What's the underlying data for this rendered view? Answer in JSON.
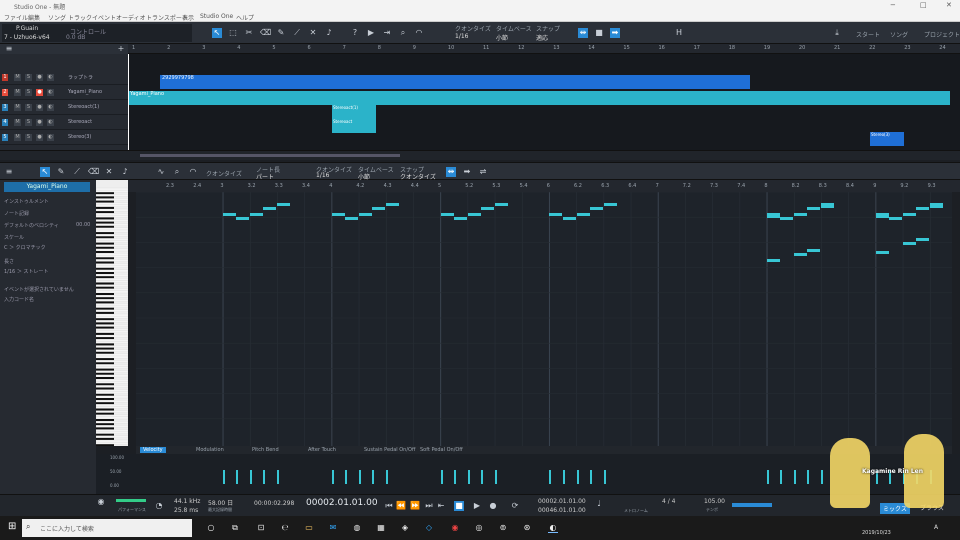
{
  "app": {
    "title": "Studio One - 無題",
    "window_controls": [
      "−",
      "□",
      "✕"
    ]
  },
  "menu": [
    "ファイル",
    "編集",
    "ソング",
    "トラック",
    "イベント",
    "オーディオ",
    "トランスポート",
    "表示",
    "Studio One",
    "ヘルプ"
  ],
  "toolbar": {
    "channel": "P.Guain",
    "preset": "7 - Uzhuo6-v64",
    "control_label": "コントロール",
    "db_value": "0.0 dB",
    "quantize_label": "クオンタイズ",
    "quantize_value": "1/16",
    "timebase_label": "タイムベース",
    "timebase_value": "小節",
    "snap_label": "スナップ",
    "snap_value": "適応",
    "right_buttons": [
      "スタート",
      "ソング",
      "プロジェクト"
    ]
  },
  "arrange": {
    "ruler_marks": [
      "1",
      "2",
      "3",
      "4",
      "5",
      "6",
      "7",
      "8",
      "9",
      "10",
      "11",
      "12",
      "13",
      "14",
      "15",
      "16",
      "17",
      "18",
      "19",
      "20",
      "21",
      "22",
      "23",
      "24"
    ],
    "tracks": [
      {
        "num": "1",
        "name": "ラップトラ",
        "color": "#c0392b"
      },
      {
        "num": "2",
        "name": "Yagami_Piano",
        "color": "#e74c3c"
      },
      {
        "num": "3",
        "name": "Stereoact(1)",
        "color": "#2980b9"
      },
      {
        "num": "4",
        "name": "Stereoact",
        "color": "#2980b9"
      },
      {
        "num": "5",
        "name": "Stereo(3)",
        "color": "#2980b9"
      }
    ],
    "clip_labels": [
      "2929979798",
      "Yagami_Piano",
      "Stereoact(1)",
      "Stereoact",
      "Stereo(3)"
    ]
  },
  "editor": {
    "tools_labels": [
      "クオンタイズ",
      "ノート長",
      "クオンタイズ",
      "タイムベース",
      "スナップ"
    ],
    "tools_values": [
      "パート",
      "1/16",
      "小節",
      "クオンタイズ"
    ],
    "ruler_marks": [
      "2.3",
      "2.4",
      "3",
      "3.2",
      "3.3",
      "3.4",
      "4",
      "4.2",
      "4.3",
      "4.4",
      "5",
      "5.2",
      "5.3",
      "5.4",
      "6",
      "6.2",
      "6.3",
      "6.4",
      "7",
      "7.2",
      "7.3",
      "7.4",
      "8",
      "8.2",
      "8.3",
      "8.4",
      "9",
      "9.2",
      "9.3"
    ],
    "octave_labels": [
      "C4",
      "C3",
      "C2",
      "C1",
      "C0"
    ],
    "control_tabs": [
      "Velocity",
      "Modulation",
      "Pitch Bend",
      "After Touch",
      "Sustain Pedal On/Off",
      "Soft Pedal On/Off"
    ],
    "vel_scale": [
      "100.00",
      "50.00",
      "0.00"
    ],
    "notes": [
      {
        "bar": 3.0,
        "pitch": 62,
        "len": 0.12
      },
      {
        "bar": 3.12,
        "pitch": 60,
        "len": 0.12
      },
      {
        "bar": 3.25,
        "pitch": 62,
        "len": 0.12
      },
      {
        "bar": 3.37,
        "pitch": 65,
        "len": 0.12
      },
      {
        "bar": 3.5,
        "pitch": 67,
        "len": 0.12
      },
      {
        "bar": 4.0,
        "pitch": 62,
        "len": 0.12
      },
      {
        "bar": 4.12,
        "pitch": 60,
        "len": 0.12
      },
      {
        "bar": 4.25,
        "pitch": 62,
        "len": 0.12
      },
      {
        "bar": 4.37,
        "pitch": 65,
        "len": 0.12
      },
      {
        "bar": 4.5,
        "pitch": 67,
        "len": 0.12
      },
      {
        "bar": 5.0,
        "pitch": 62,
        "len": 0.12
      },
      {
        "bar": 5.12,
        "pitch": 60,
        "len": 0.12
      },
      {
        "bar": 5.25,
        "pitch": 62,
        "len": 0.12
      },
      {
        "bar": 5.37,
        "pitch": 65,
        "len": 0.12
      },
      {
        "bar": 5.5,
        "pitch": 67,
        "len": 0.12
      },
      {
        "bar": 6.0,
        "pitch": 62,
        "len": 0.12
      },
      {
        "bar": 6.12,
        "pitch": 60,
        "len": 0.12
      },
      {
        "bar": 6.25,
        "pitch": 62,
        "len": 0.12
      },
      {
        "bar": 6.37,
        "pitch": 65,
        "len": 0.12
      },
      {
        "bar": 6.5,
        "pitch": 67,
        "len": 0.12
      },
      {
        "bar": 8.0,
        "pitch": 62,
        "len": 0.12
      },
      {
        "bar": 8.0,
        "pitch": 61,
        "len": 0.12
      },
      {
        "bar": 8.12,
        "pitch": 60,
        "len": 0.12
      },
      {
        "bar": 8.25,
        "pitch": 62,
        "len": 0.12
      },
      {
        "bar": 8.37,
        "pitch": 65,
        "len": 0.12
      },
      {
        "bar": 8.5,
        "pitch": 67,
        "len": 0.12
      },
      {
        "bar": 8.5,
        "pitch": 66,
        "len": 0.12
      },
      {
        "bar": 8.0,
        "pitch": 40,
        "len": 0.12
      },
      {
        "bar": 8.25,
        "pitch": 43,
        "len": 0.12
      },
      {
        "bar": 8.37,
        "pitch": 45,
        "len": 0.12
      },
      {
        "bar": 9.0,
        "pitch": 62,
        "len": 0.12
      },
      {
        "bar": 9.0,
        "pitch": 61,
        "len": 0.12
      },
      {
        "bar": 9.12,
        "pitch": 60,
        "len": 0.12
      },
      {
        "bar": 9.25,
        "pitch": 62,
        "len": 0.12
      },
      {
        "bar": 9.37,
        "pitch": 65,
        "len": 0.12
      },
      {
        "bar": 9.5,
        "pitch": 67,
        "len": 0.12
      },
      {
        "bar": 9.5,
        "pitch": 66,
        "len": 0.12
      },
      {
        "bar": 9.0,
        "pitch": 44,
        "len": 0.12
      },
      {
        "bar": 9.25,
        "pitch": 48,
        "len": 0.12
      },
      {
        "bar": 9.37,
        "pitch": 50,
        "len": 0.12
      }
    ]
  },
  "inspector": {
    "title": "Yagami_Piano",
    "rows": [
      "インストゥルメント",
      "ノート記録",
      "デフォルトのベロシティ",
      "スケール",
      "C  ＞ クロマチック",
      "長さ",
      "1/16  ＞  ストレート",
      "イベントが選択されていません",
      "入力コード名"
    ],
    "velocity_value": "00.00"
  },
  "transport": {
    "sample_rate": "44.1 kHz",
    "sample_rate_label": "最大記録時間",
    "rec_time": "58.00 日",
    "latency": "25.8 ms",
    "perf_label": "パフォーマンス",
    "time_seconds": "00:00:02.298",
    "position": "00002.01.01.00",
    "loop_start": "00002.01.01.00",
    "loop_end": "00046.01.01.00",
    "signature": "4 / 4",
    "tempo": "105.00",
    "tempo_label": "テンポ",
    "sig_label": "メトロノーム",
    "right_tabs": [
      "ミックス",
      "ブラウズ"
    ]
  },
  "taskbar": {
    "search_placeholder": "ここに入力して検索",
    "clock": "2019/10/23",
    "language": "A"
  },
  "overlay": {
    "watermark": "Kagamine Rin Len"
  },
  "colors": {
    "accent": "#2a8bd6",
    "note": "#38c6d4",
    "clip_blue": "#1f6fd6",
    "clip_cyan": "#2bb3c9"
  }
}
